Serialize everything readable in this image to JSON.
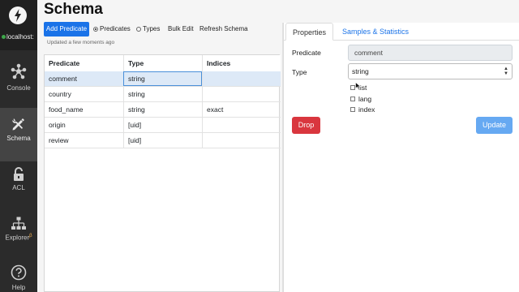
{
  "sidebar": {
    "host": "localhost:",
    "items": [
      {
        "label": "Console",
        "icon": "share-nodes-icon"
      },
      {
        "label": "Schema",
        "icon": "wrench-pencil-icon"
      },
      {
        "label": "ACL",
        "icon": "unlock-icon"
      },
      {
        "label": "Explorer",
        "beta": "β",
        "icon": "sitemap-icon"
      },
      {
        "label": "Help",
        "icon": "question-circle-icon"
      }
    ]
  },
  "header": {
    "title": "Schema"
  },
  "toolbar": {
    "add_predicate": "Add Predicate",
    "radio_predicates": "Predicates",
    "radio_types": "Types",
    "bulk_edit": "Bulk Edit",
    "refresh_schema": "Refresh Schema",
    "updated": "Updated a few moments ago"
  },
  "table": {
    "headers": [
      "Predicate",
      "Type",
      "Indices"
    ],
    "rows": [
      [
        "comment",
        "string",
        ""
      ],
      [
        "country",
        "string",
        ""
      ],
      [
        "food_name",
        "string",
        "exact"
      ],
      [
        "origin",
        "[uid]",
        ""
      ],
      [
        "review",
        "[uid]",
        ""
      ]
    ]
  },
  "panel": {
    "tabs": [
      "Properties",
      "Samples & Statistics"
    ],
    "predicate_label": "Predicate",
    "predicate_value": "comment",
    "type_label": "Type",
    "type_value": "string",
    "options": [
      "list",
      "lang",
      "index"
    ],
    "drop": "Drop",
    "update": "Update"
  },
  "colors": {
    "primary": "#1a73e8",
    "danger": "#d9363e",
    "update": "#66a9f2",
    "sidebar": "#2b2b2b"
  }
}
